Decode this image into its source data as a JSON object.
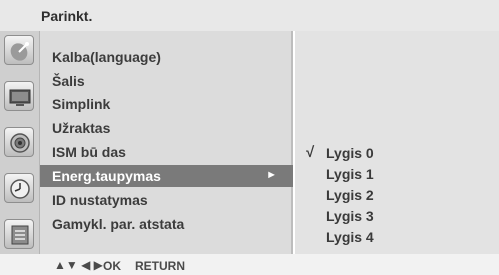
{
  "title": "Parinkt.",
  "menu": {
    "items": [
      {
        "label": "Kalba(language)"
      },
      {
        "label": "Šalis"
      },
      {
        "label": "Simplink"
      },
      {
        "label": "Užraktas"
      },
      {
        "label": "ISM bū das"
      },
      {
        "label": "Energ.taupymas",
        "selected": true,
        "arrow": "►"
      },
      {
        "label": "ID nustatymas"
      },
      {
        "label": "Gamykl. par. atstata"
      }
    ]
  },
  "submenu": {
    "check_mark": "√",
    "options": [
      {
        "label": "Lygis 0",
        "checked": true
      },
      {
        "label": "Lygis 1"
      },
      {
        "label": "Lygis 2"
      },
      {
        "label": "Lygis 3"
      },
      {
        "label": "Lygis 4"
      }
    ]
  },
  "sidebar_icons": [
    "satellite-dish-icon",
    "monitor-icon",
    "speaker-icon",
    "clock-icon",
    "settings-list-icon"
  ],
  "footer": {
    "nav_arrows": "▲▼ ◀ ▶",
    "ok": "OK",
    "return": "RETURN"
  },
  "colors": {
    "selected_bg": "#7a7a7a",
    "menu_bg": "#dcdcdc",
    "submenu_bg": "#e3e3e3",
    "title_bg": "#e8e8e8"
  }
}
